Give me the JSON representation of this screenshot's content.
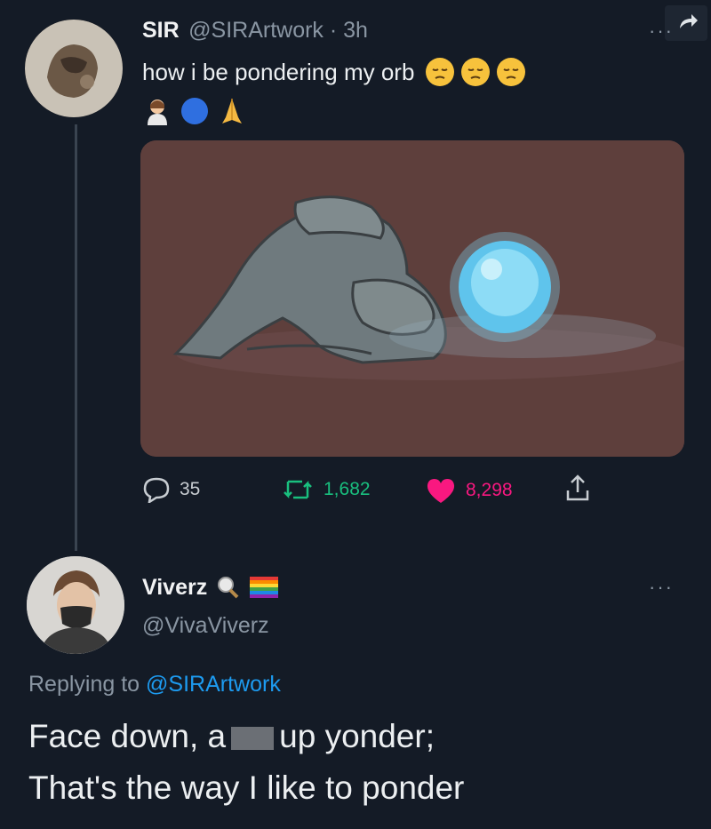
{
  "tweet": {
    "display_name": "SIR",
    "handle_time": "@SIRArtwork · 3h",
    "text": "how i be pondering my orb",
    "text_emojis": [
      "pensive-face",
      "pensive-face",
      "pensive-face"
    ],
    "second_line_emojis": [
      "person-with-veil",
      "blue-circle",
      "folded-hands"
    ],
    "media_alt_icon": "orb-pondering-illustration",
    "actions": {
      "replies": "35",
      "retweets": "1,682",
      "likes": "8,298"
    },
    "colors": {
      "retweet": "#19bf7e",
      "like": "#f91880",
      "muted": "#8a96a3"
    }
  },
  "reply": {
    "display_name": "Viverz",
    "handle": "@VivaViverz",
    "replying_prefix": "Replying to",
    "replying_mention": "@SIRArtwork",
    "line1_before": "Face down, a",
    "line1_after": "up yonder;",
    "line2": "That's the way I like to ponder",
    "name_emojis": [
      "magnifying-glass",
      "rainbow-flag"
    ]
  },
  "header_icon": "share-arrow-icon"
}
